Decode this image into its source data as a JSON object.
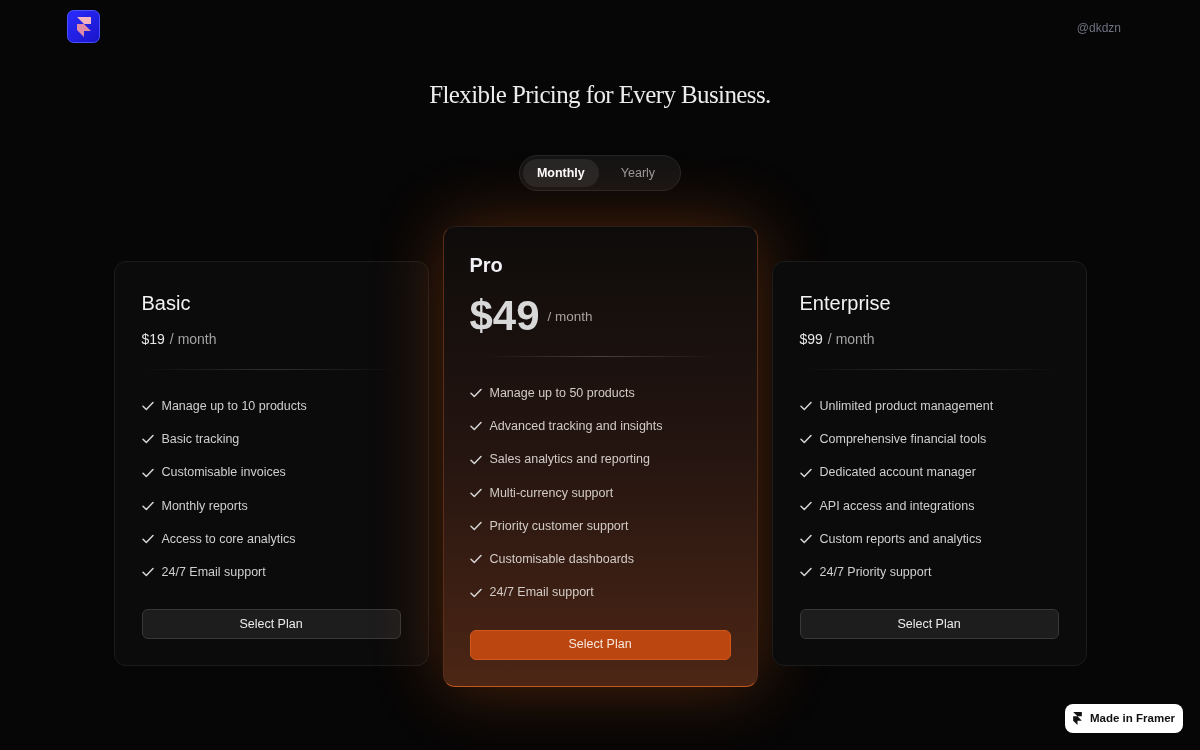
{
  "header": {
    "handle": "@dkdzn"
  },
  "title": "Flexible Pricing for Every Business.",
  "billing_toggle": [
    {
      "label": "Monthly",
      "selected": true
    },
    {
      "label": "Yearly",
      "selected": false
    }
  ],
  "plans": [
    {
      "name": "Basic",
      "price": "$19",
      "period": "/ month",
      "featured": false,
      "features": [
        "Manage up to 10 products",
        "Basic tracking",
        "Customisable invoices",
        "Monthly reports",
        "Access to core analytics",
        "24/7 Email support"
      ],
      "button": "Select Plan"
    },
    {
      "name": "Pro",
      "price": "$49",
      "period": "/ month",
      "featured": true,
      "features": [
        "Manage up to 50 products",
        "Advanced tracking and insights",
        "Sales analytics and reporting",
        "Multi-currency support",
        "Priority customer support",
        "Customisable dashboards",
        "24/7 Email support"
      ],
      "button": "Select Plan"
    },
    {
      "name": "Enterprise",
      "price": "$99",
      "period": "/ month",
      "featured": false,
      "features": [
        "Unlimited product management",
        "Comprehensive financial tools",
        "Dedicated account manager",
        "API access and integrations",
        "Custom reports and analytics",
        "24/7 Priority support"
      ],
      "button": "Select Plan"
    }
  ],
  "badge": {
    "label": "Made in Framer"
  }
}
